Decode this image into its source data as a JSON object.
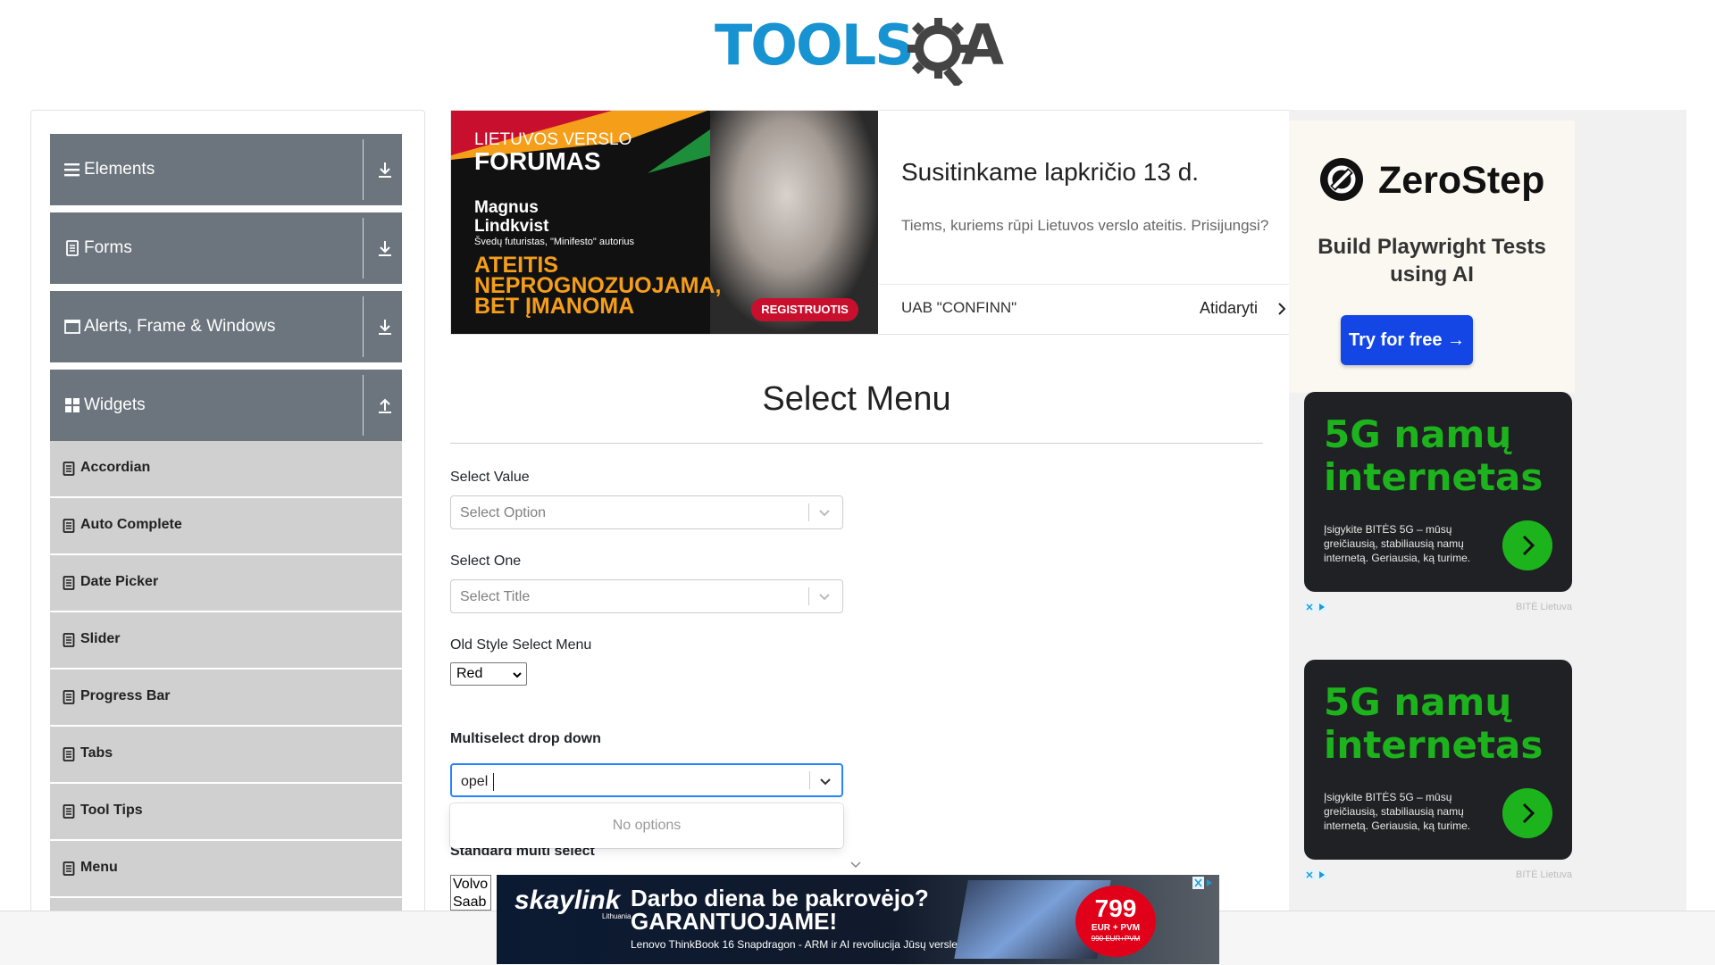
{
  "logo": {
    "text_left": "TOOLS",
    "text_right": "A"
  },
  "sidebar": {
    "groups": [
      {
        "label": "Elements",
        "icon": "bars-icon",
        "toggle": "download-arrow-icon"
      },
      {
        "label": "Forms",
        "icon": "document-icon",
        "toggle": "download-arrow-icon"
      },
      {
        "label": "Alerts, Frame & Windows",
        "icon": "window-icon",
        "toggle": "download-arrow-icon"
      },
      {
        "label": "Widgets",
        "icon": "grid-icon",
        "toggle": "upload-arrow-icon"
      }
    ],
    "items": [
      {
        "label": "Accordian"
      },
      {
        "label": "Auto Complete"
      },
      {
        "label": "Date Picker"
      },
      {
        "label": "Slider"
      },
      {
        "label": "Progress Bar"
      },
      {
        "label": "Tabs"
      },
      {
        "label": "Tool Tips"
      },
      {
        "label": "Menu"
      }
    ]
  },
  "top_ad": {
    "forum_line1": "LIETUVOS VERSLO",
    "forum_line2": "FORUMAS",
    "person": "Magnus Lindkvist",
    "person_desc": "Švedų futuristas, \"Minifesto\" autorius",
    "slogan": "ATEITIS NEPROGNOZUOJAMA, BET ĮMANOMA",
    "cta": "REGISTRUOTIS",
    "headline": "Susitinkame lapkričio 13 d.",
    "subtext": "Tiems, kuriems rūpi Lietuvos verslo ateitis. Prisijungsi?",
    "company": "UAB \"CONFINN\"",
    "open": "Atidaryti"
  },
  "main": {
    "title": "Select Menu",
    "select_value": {
      "label": "Select Value",
      "placeholder": "Select Option"
    },
    "select_one": {
      "label": "Select One",
      "placeholder": "Select Title"
    },
    "old_style": {
      "label": "Old Style Select Menu",
      "value": "Red"
    },
    "multiselect": {
      "label": "Multiselect drop down",
      "input": "opel",
      "no_options": "No options"
    },
    "standard_multi": {
      "label": "Standard multi select",
      "options": [
        "Volvo",
        "Saab"
      ]
    }
  },
  "right_ads": {
    "zerostep": {
      "name": "ZeroStep",
      "tagline": "Build Playwright Tests using AI",
      "button": "Try for free →"
    },
    "bite": [
      {
        "title": "5G namų internetas",
        "text": "Įsigykite BITĖS 5G – mūsų greičiausią, stabiliausią namų internetą. Geriausia, ką turime.",
        "brand": "BITĖ Lietuva"
      },
      {
        "title": "5G namų internetas",
        "text": "Įsigykite BITĖS 5G – mūsų greičiausią, stabiliausią namų internetą. Geriausia, ką turime.",
        "brand": "BITĖ Lietuva"
      }
    ]
  },
  "bottom_ad": {
    "brand": "skaylink",
    "brand_sub": "Lithuania",
    "line1": "Darbo diena be pakrovėjo?",
    "line2": "GARANTUOJAME!",
    "small": "Lenovo ThinkBook 16 Snapdragon - ARM ir AI revoliucija Jūsų versle!",
    "price": "799",
    "price_unit": "EUR + PVM",
    "old_price": "990 EUR+PVM"
  },
  "colors": {
    "brand_blue": "#1893d2",
    "sidebar_group": "#6c757d",
    "sidebar_item": "#d0d0d0",
    "focus": "#2684ff",
    "bite_green": "#1db31d",
    "zerostep_blue": "#1446e6"
  }
}
